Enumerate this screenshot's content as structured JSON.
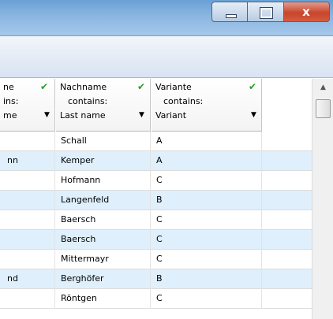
{
  "window": {
    "minimize_icon": "minimize-icon",
    "maximize_icon": "maximize-icon",
    "close_label": "x"
  },
  "grid": {
    "columns": [
      {
        "title": "ne",
        "filter_label": "ins:",
        "field": "me",
        "filter_active": true
      },
      {
        "title": "Nachname",
        "filter_label": "contains:",
        "field": "Last name",
        "filter_active": true
      },
      {
        "title": "Variante",
        "filter_label": "contains:",
        "field": "Variant",
        "filter_active": true
      }
    ],
    "rows": [
      {
        "c1": "",
        "c2": "Schall",
        "c3": "A"
      },
      {
        "c1": "nn",
        "c2": "Kemper",
        "c3": "A"
      },
      {
        "c1": "",
        "c2": "Hofmann",
        "c3": "C"
      },
      {
        "c1": "",
        "c2": "Langenfeld",
        "c3": "B"
      },
      {
        "c1": "",
        "c2": "Baersch",
        "c3": "C"
      },
      {
        "c1": "",
        "c2": "Baersch",
        "c3": "C"
      },
      {
        "c1": "",
        "c2": "Mittermayr",
        "c3": "C"
      },
      {
        "c1": "nd",
        "c2": "Berghöfer",
        "c3": "B"
      },
      {
        "c1": "",
        "c2": "Röntgen",
        "c3": "C"
      }
    ]
  },
  "colors": {
    "row_alt": "#dfeffc",
    "check": "#2a9a2a",
    "titlebar": "#8ab6e1"
  }
}
